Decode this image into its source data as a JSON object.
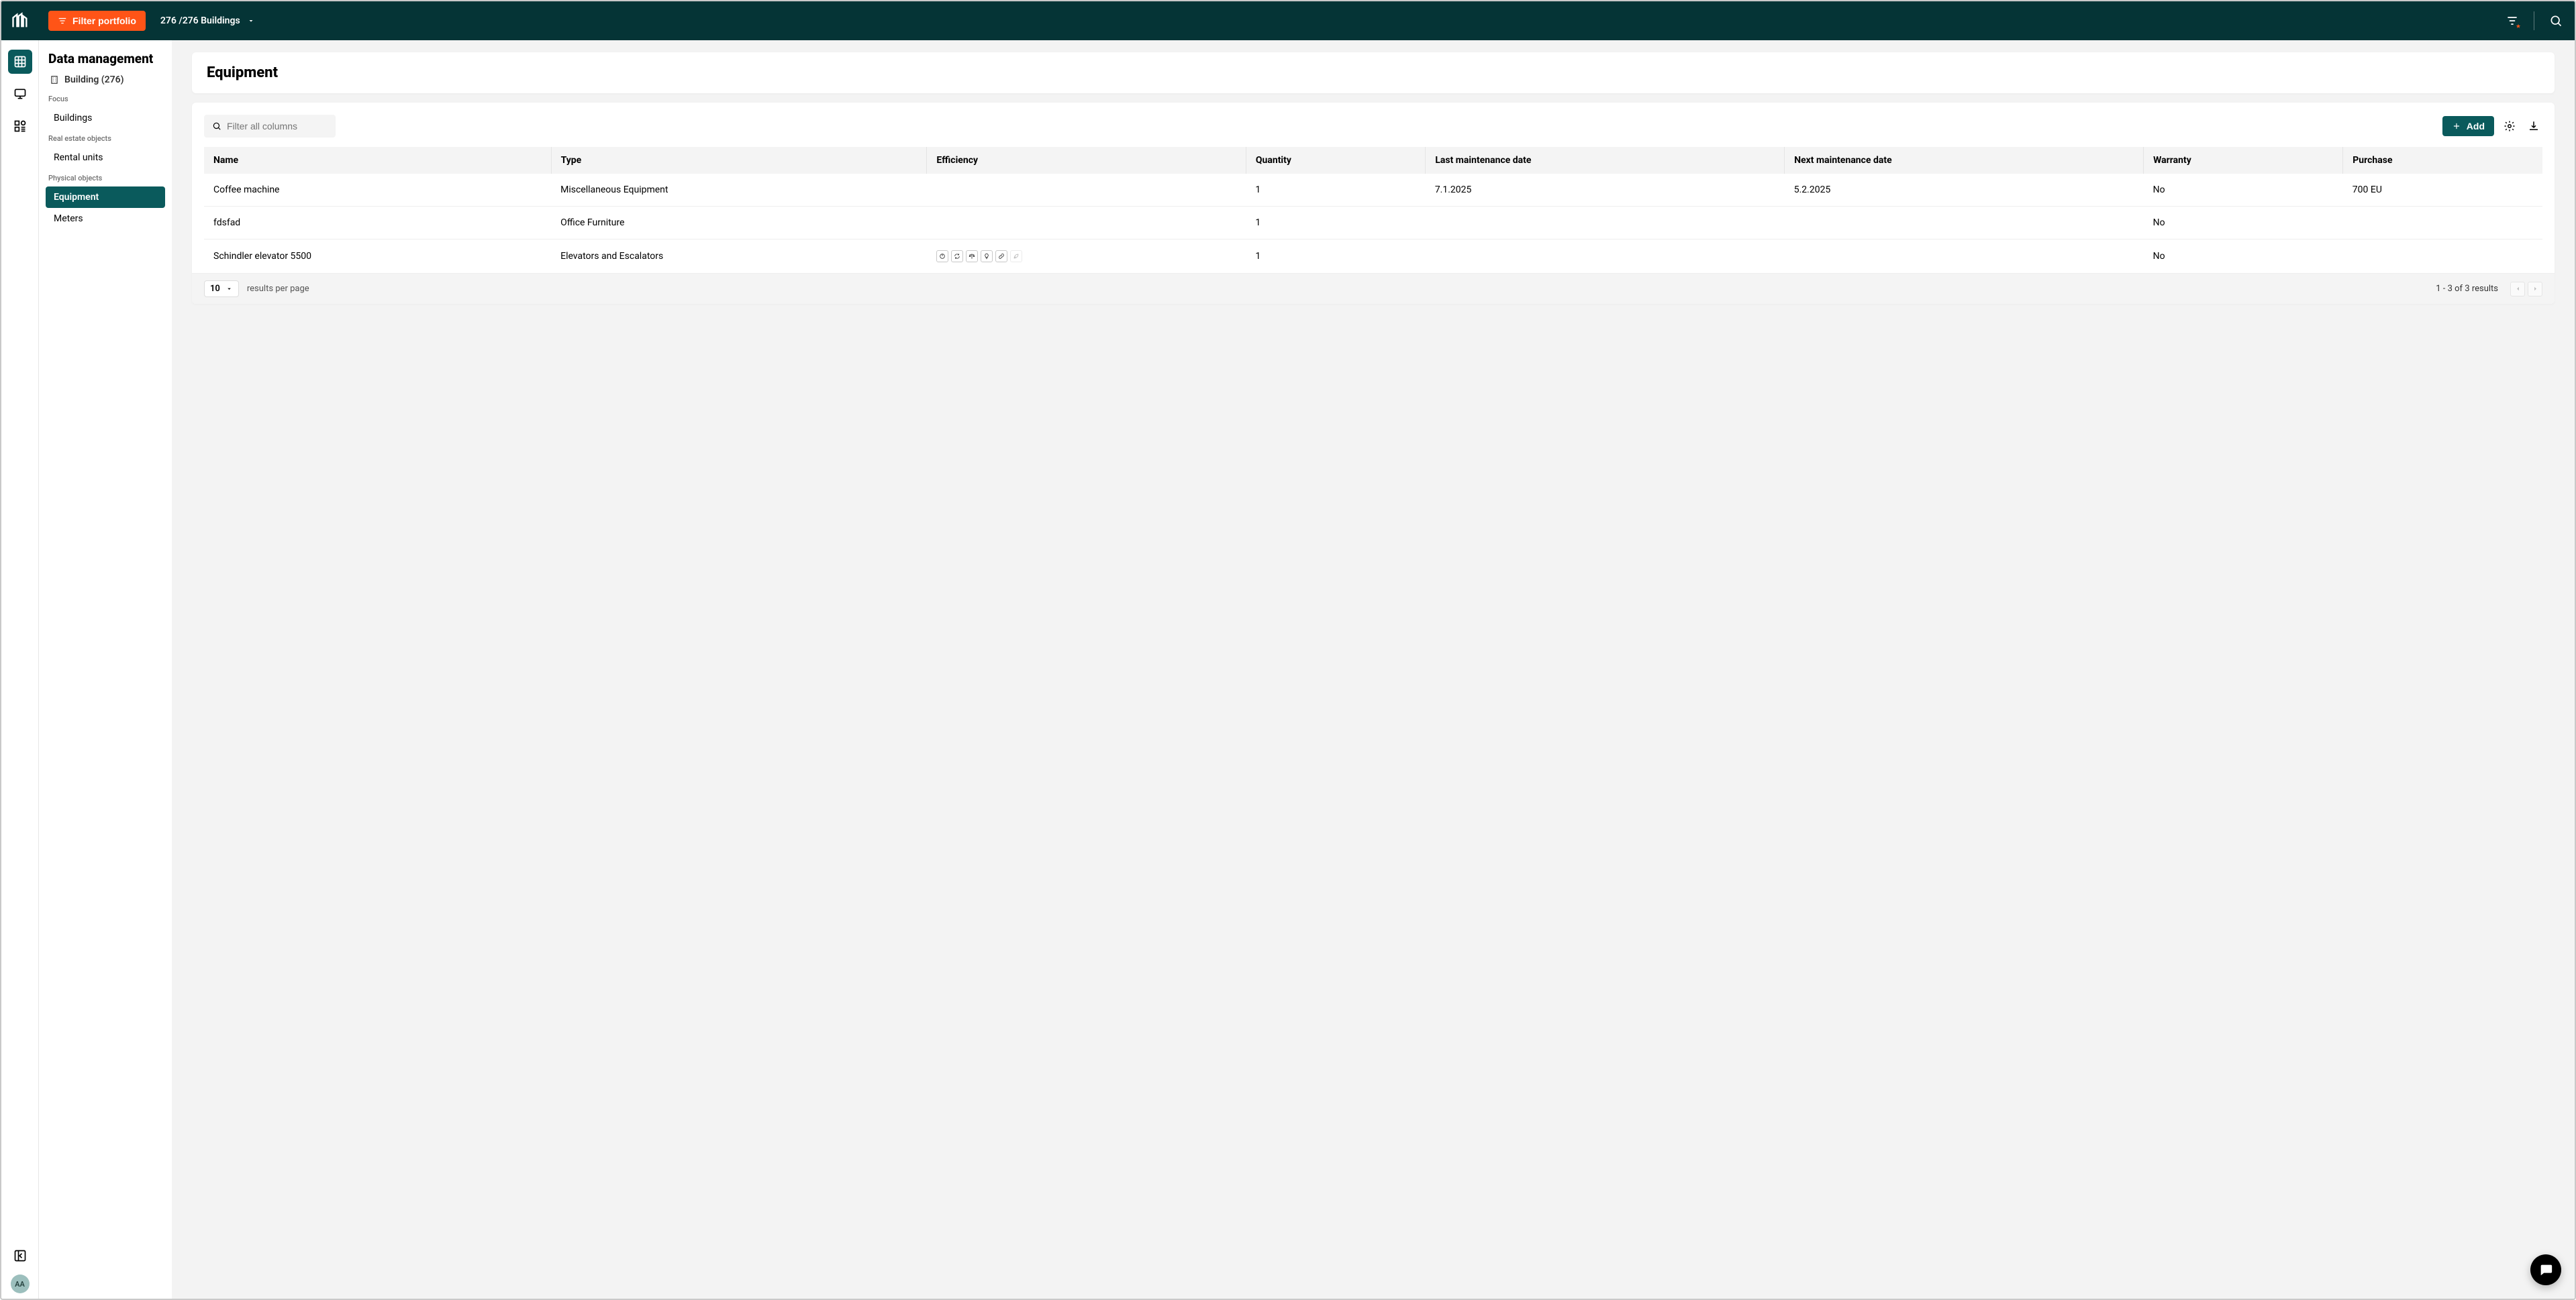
{
  "header": {
    "filter_label": "Filter portfolio",
    "building_count": "276 /276 Buildings"
  },
  "sidebar": {
    "title": "Data management",
    "scope": "Building (276)",
    "groups": [
      {
        "label": "Focus",
        "items": [
          {
            "label": "Buildings",
            "active": false
          }
        ]
      },
      {
        "label": "Real estate objects",
        "items": [
          {
            "label": "Rental units",
            "active": false
          }
        ]
      },
      {
        "label": "Physical objects",
        "items": [
          {
            "label": "Equipment",
            "active": true
          },
          {
            "label": "Meters",
            "active": false
          }
        ]
      }
    ]
  },
  "avatar": "AA",
  "page": {
    "title": "Equipment",
    "search_placeholder": "Filter all columns",
    "add_label": "Add"
  },
  "table": {
    "columns": [
      "Name",
      "Type",
      "Efficiency",
      "Quantity",
      "Last maintenance date",
      "Next maintenance date",
      "Warranty",
      "Purchase"
    ],
    "rows": [
      {
        "name": "Coffee machine",
        "type": "Miscellaneous Equipment",
        "efficiency": null,
        "quantity": "1",
        "last": "7.1.2025",
        "next": "5.2.2025",
        "warranty": "No",
        "purchase": "700 EU"
      },
      {
        "name": "fdsfad",
        "type": "Office Furniture",
        "efficiency": null,
        "quantity": "1",
        "last": "",
        "next": "",
        "warranty": "No",
        "purchase": ""
      },
      {
        "name": "Schindler elevator 5500",
        "type": "Elevators and Escalators",
        "efficiency": "icons",
        "quantity": "1",
        "last": "",
        "next": "",
        "warranty": "No",
        "purchase": ""
      }
    ]
  },
  "pager": {
    "page_size": "10",
    "per_page_label": "results per page",
    "results": "1 -  3 of  3 results"
  }
}
